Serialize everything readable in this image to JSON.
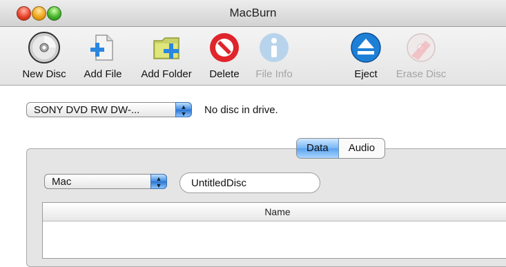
{
  "window": {
    "title": "MacBurn"
  },
  "toolbar": {
    "items": [
      {
        "label": "New Disc",
        "icon": "new-disc-icon",
        "enabled": true
      },
      {
        "label": "Add File",
        "icon": "add-file-icon",
        "enabled": true
      },
      {
        "label": "Add Folder",
        "icon": "add-folder-icon",
        "enabled": true
      },
      {
        "label": "Delete",
        "icon": "delete-icon",
        "enabled": true
      },
      {
        "label": "File Info",
        "icon": "info-icon",
        "enabled": false
      },
      {
        "label": "Eject",
        "icon": "eject-icon",
        "enabled": true
      },
      {
        "label": "Erase Disc",
        "icon": "erase-disc-icon",
        "enabled": false
      }
    ]
  },
  "drive": {
    "selected": "SONY DVD RW DW-...",
    "status": "No disc in drive."
  },
  "tabs": {
    "items": [
      "Data",
      "Audio"
    ],
    "active": "Data"
  },
  "disc": {
    "format": "Mac",
    "name": "UntitledDisc"
  },
  "table": {
    "columns": [
      "Name"
    ]
  },
  "colors": {
    "accent": "#5aa3ef",
    "delete": "#e0242b",
    "eject": "#1e7fd6"
  }
}
